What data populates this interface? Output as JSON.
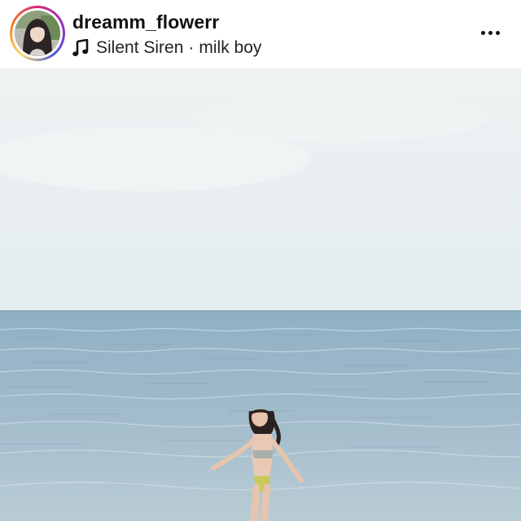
{
  "post": {
    "username": "dreamm_flowerr",
    "audio": {
      "icon": "music-note-icon",
      "artist": "Silent Siren",
      "separator": "·",
      "track": "milk boy"
    },
    "more_icon": "more-options-icon",
    "image": {
      "subject": "woman in bikini walking into the sea",
      "colors": {
        "sky_top": "#eef2f3",
        "sky_bottom": "#e4ecef",
        "sea_top": "#8fb0c4",
        "sea_bottom": "#b9ccd5"
      }
    }
  }
}
